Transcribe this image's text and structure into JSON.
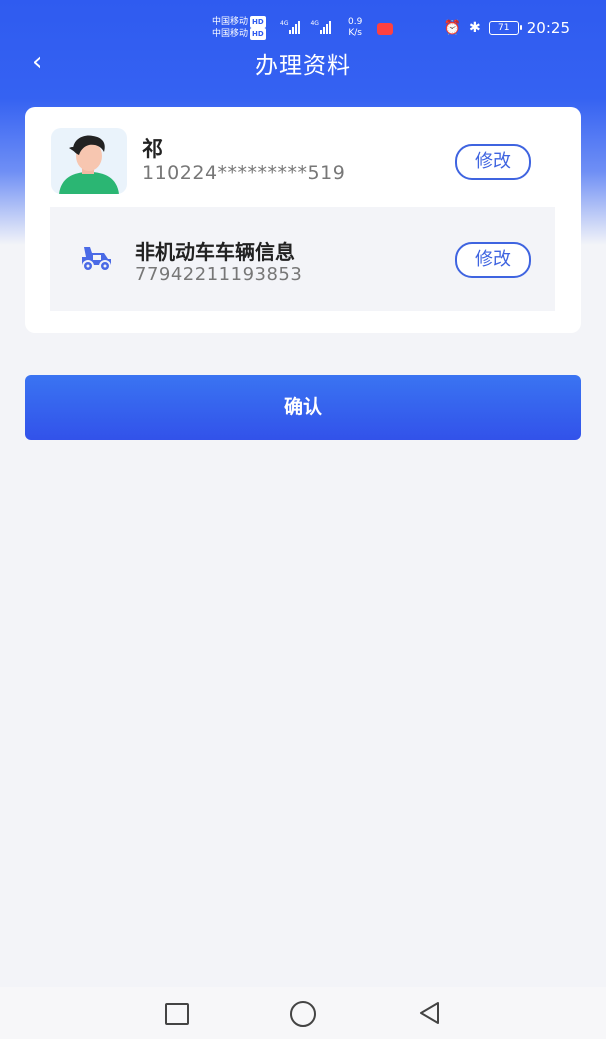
{
  "status_bar": {
    "carrier_1": "中国移动",
    "carrier_2": "中国移动",
    "hd": "HD",
    "network_1": "4G",
    "network_2": "4G",
    "speed_value": "0.9",
    "speed_unit": "K/s",
    "battery": "71",
    "time": "20:25"
  },
  "header": {
    "back_icon": "chevron-left-icon",
    "back_symbol": "‹",
    "title": "办理资料"
  },
  "person": {
    "name": "祁",
    "id_number": "110224*********519",
    "edit_label": "修改"
  },
  "vehicle": {
    "title": "非机动车车辆信息",
    "number": "77942211193853",
    "edit_label": "修改"
  },
  "confirm_label": "确认",
  "colors": {
    "brand_blue": "#3252ea",
    "accent_blue": "#3f64e0",
    "background": "#f3f4f8"
  }
}
